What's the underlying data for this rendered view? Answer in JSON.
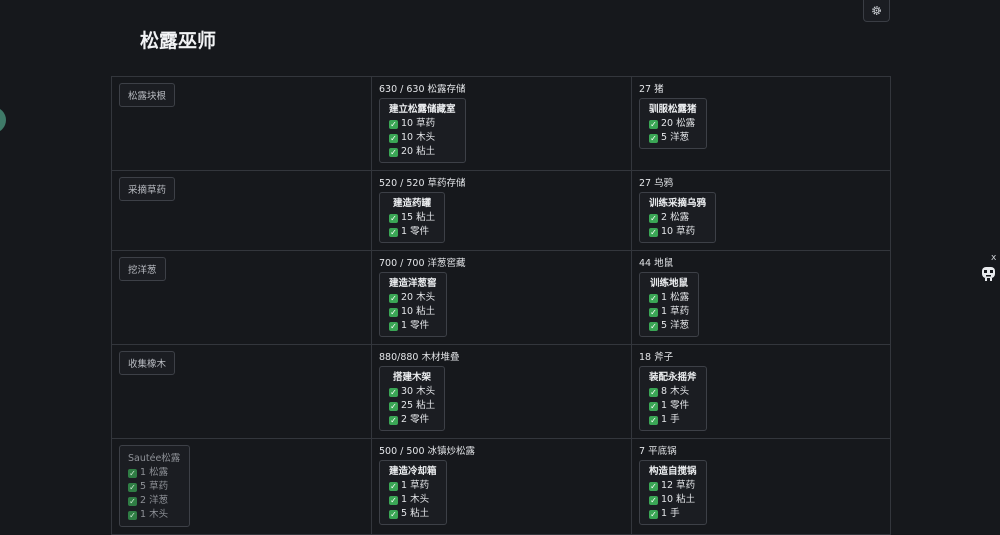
{
  "app": {
    "title": "松露巫师",
    "close_label": "x"
  },
  "icons": {
    "settings": "gear-icon",
    "mascot": "mascot-icon",
    "check": "check-mark-icon"
  },
  "colors": {
    "background": "#16181c",
    "check": "#3aa655",
    "border": "#33363c"
  },
  "rows": [
    {
      "action": {
        "label": "松露块根"
      },
      "storage": {
        "status": "630 / 630 松露存储",
        "card": {
          "title": "建立松露储藏室",
          "reqs": [
            "10 草药",
            "10 木头",
            "20 粘土"
          ]
        }
      },
      "unit": {
        "status": "27 猪",
        "card": {
          "title": "驯服松露猪",
          "reqs": [
            "20 松露",
            "5 洋葱"
          ]
        }
      }
    },
    {
      "action": {
        "label": "采摘草药"
      },
      "storage": {
        "status": "520 / 520 草药存储",
        "card": {
          "title": "建造药罐",
          "reqs": [
            "15 粘土",
            "1 零件"
          ]
        }
      },
      "unit": {
        "status": "27 乌鸦",
        "card": {
          "title": "训练采摘乌鸦",
          "reqs": [
            "2 松露",
            "10 草药"
          ]
        }
      }
    },
    {
      "action": {
        "label": "挖洋葱"
      },
      "storage": {
        "status": "700 / 700 洋葱窖藏",
        "card": {
          "title": "建造洋葱窖",
          "reqs": [
            "20 木头",
            "10 粘土",
            "1 零件"
          ]
        }
      },
      "unit": {
        "status": "44 地鼠",
        "card": {
          "title": "训练地鼠",
          "reqs": [
            "1 松露",
            "1 草药",
            "5 洋葱"
          ]
        }
      }
    },
    {
      "action": {
        "label": "收集橡木"
      },
      "storage": {
        "status": "880/880 木材堆叠",
        "card": {
          "title": "搭建木架",
          "reqs": [
            "30 木头",
            "25 粘土",
            "2 零件"
          ]
        }
      },
      "unit": {
        "status": "18 斧子",
        "card": {
          "title": "装配永摇斧",
          "reqs": [
            "8 木头",
            "1 零件",
            "1 手"
          ]
        }
      }
    },
    {
      "action": {
        "label": "Sautée松露",
        "reqs": [
          "1 松露",
          "5 草药",
          "2 洋葱",
          "1 木头"
        ]
      },
      "storage": {
        "status": "500 / 500 冰镇炒松露",
        "card": {
          "title": "建造冷却箱",
          "reqs": [
            "1 草药",
            "1 木头",
            "5 粘土"
          ]
        }
      },
      "unit": {
        "status": "7 平底锅",
        "card": {
          "title": "构造自搅锅",
          "reqs": [
            "12 草药",
            "10 粘土",
            "1 手"
          ]
        }
      }
    }
  ]
}
